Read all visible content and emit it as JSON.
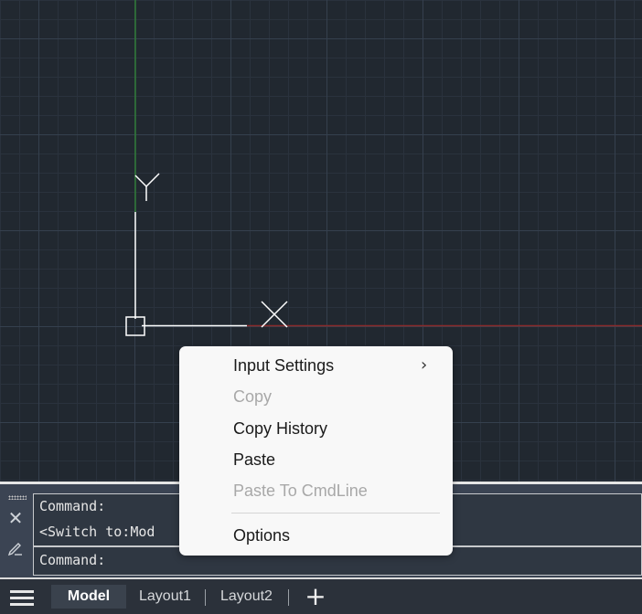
{
  "canvas": {
    "ucs_y_label": "Y",
    "ucs_x_label": "X"
  },
  "command_line": {
    "history": [
      "Command:",
      "<Switch to:Mod"
    ],
    "input_prompt": "Command:"
  },
  "tabs": {
    "items": [
      {
        "label": "Model",
        "active": true
      },
      {
        "label": "Layout1",
        "active": false
      },
      {
        "label": "Layout2",
        "active": false
      }
    ],
    "add_label": "+"
  },
  "context_menu": {
    "items": [
      {
        "label": "Input Settings",
        "enabled": true,
        "has_submenu": true
      },
      {
        "label": "Copy",
        "enabled": false
      },
      {
        "label": "Copy History",
        "enabled": true
      },
      {
        "label": "Paste",
        "enabled": true
      },
      {
        "label": "Paste To CmdLine",
        "enabled": false
      },
      {
        "label": "Options",
        "enabled": true
      }
    ],
    "submenu_arrow": "›"
  },
  "colors": {
    "canvas_bg": "#212830",
    "x_axis": "#8b2a2a",
    "y_axis": "#2f7a37",
    "ucs": "#ffffff"
  }
}
